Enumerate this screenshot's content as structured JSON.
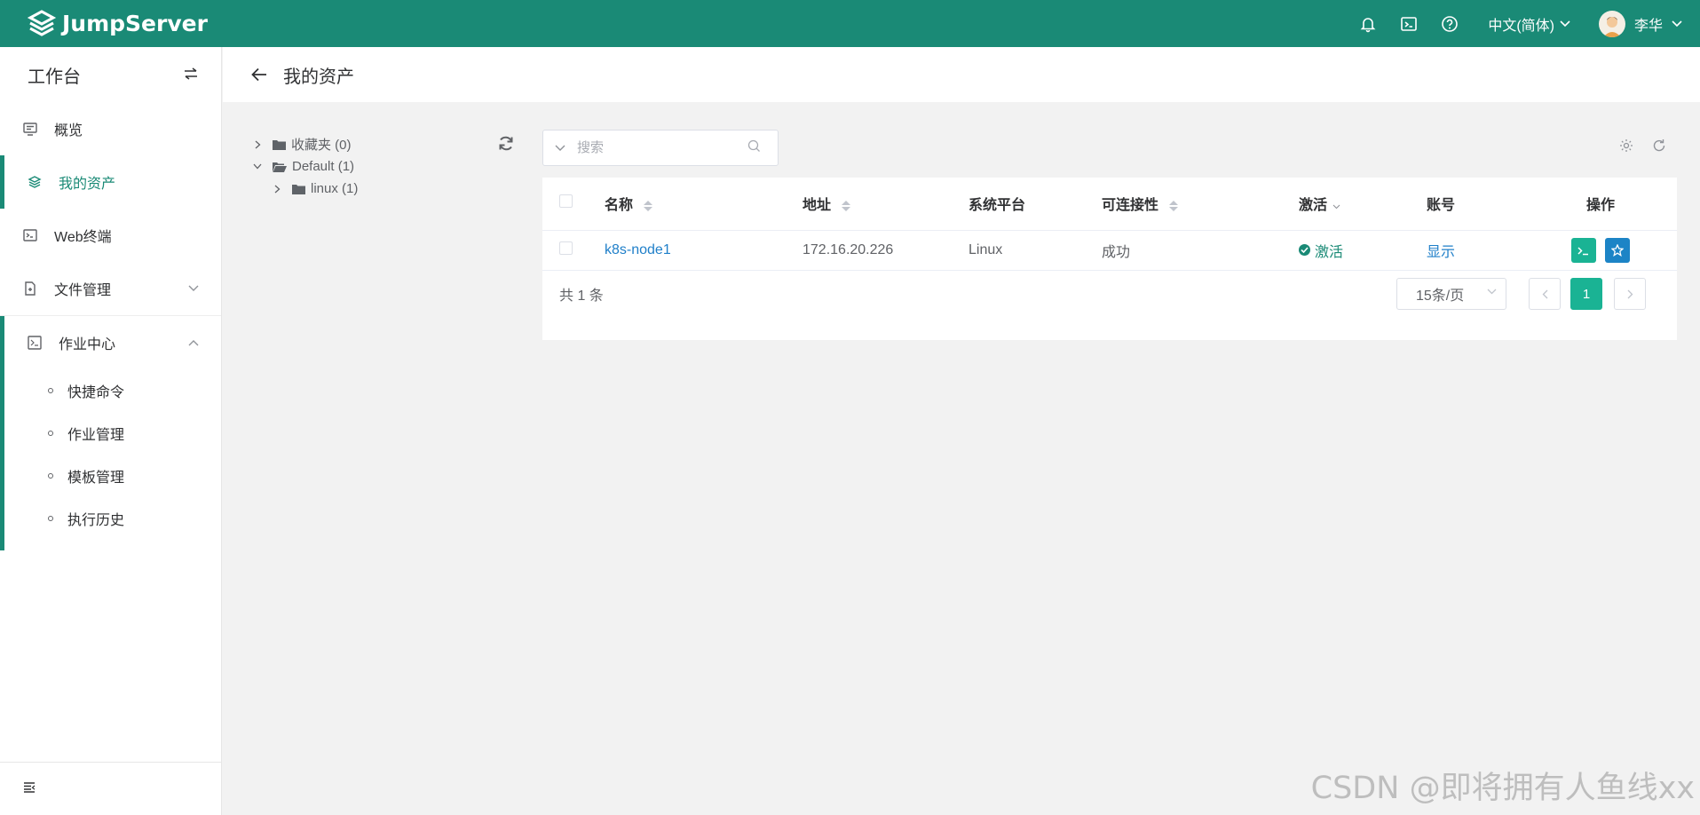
{
  "topbar": {
    "brand": "JumpServer",
    "lang": "中文(简体)",
    "user_name": "李华",
    "icons": [
      "bell-icon",
      "terminal-icon",
      "help-icon"
    ]
  },
  "sidebar": {
    "title": "工作台",
    "items": [
      {
        "label": "概览",
        "icon": "monitor-icon"
      },
      {
        "label": "我的资产",
        "icon": "layers-icon",
        "active": true
      },
      {
        "label": "Web终端",
        "icon": "terminal-icon"
      },
      {
        "label": "文件管理",
        "icon": "file-icon"
      }
    ],
    "group": {
      "label": "作业中心",
      "children": [
        "快捷命令",
        "作业管理",
        "模板管理",
        "执行历史"
      ]
    }
  },
  "page": {
    "title": "我的资产"
  },
  "tree": {
    "nodes": [
      {
        "label": "收藏夹 (0)",
        "expanded": false
      },
      {
        "label": "Default (1)",
        "expanded": true
      },
      {
        "label": "linux (1)",
        "expanded": false
      }
    ]
  },
  "search": {
    "placeholder": "搜索"
  },
  "table": {
    "headers": {
      "name": "名称",
      "address": "地址",
      "platform": "系统平台",
      "connectivity": "可连接性",
      "active": "激活",
      "accounts": "账号",
      "actions": "操作"
    },
    "rows": [
      {
        "name": "k8s-node1",
        "address": "172.16.20.226",
        "platform": "Linux",
        "connectivity": "成功",
        "active": "激活",
        "accounts": "显示"
      }
    ]
  },
  "pagination": {
    "total": "共 1 条",
    "page_size": "15条/页",
    "current": "1"
  },
  "watermark": "CSDN @即将拥有人鱼线xx",
  "colors": {
    "primary": "#1a8a76",
    "button_green": "#1ab394",
    "button_blue": "#1c84c6",
    "link": "#1f7fc9"
  }
}
